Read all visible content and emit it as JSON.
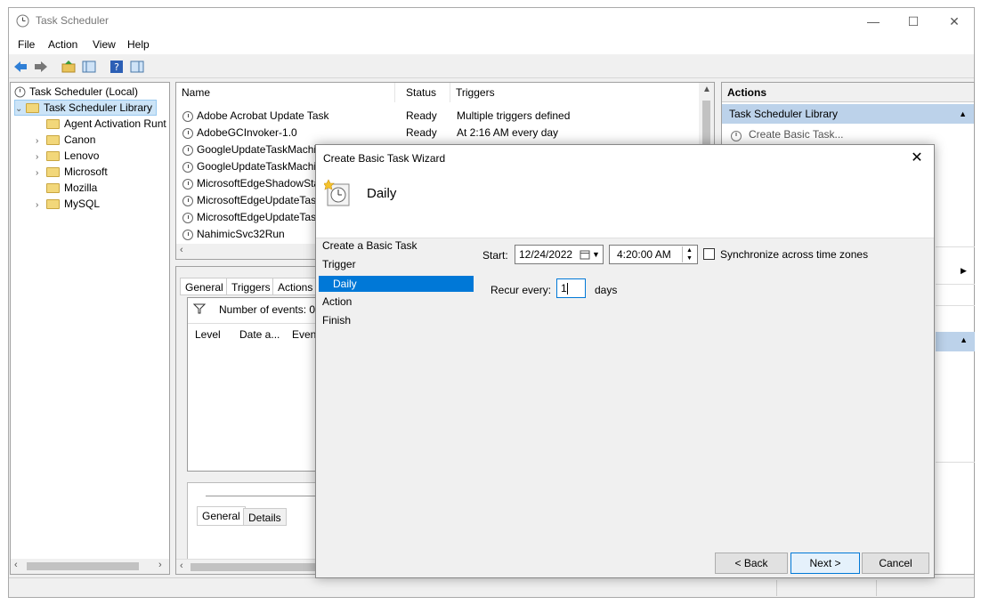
{
  "app": {
    "title": "Task Scheduler"
  },
  "menu": [
    "File",
    "Action",
    "View",
    "Help"
  ],
  "tree": {
    "root": "Task Scheduler (Local)",
    "library": "Task Scheduler Library",
    "folders": [
      "Agent Activation Runt",
      "Canon",
      "Lenovo",
      "Microsoft",
      "Mozilla",
      "MySQL"
    ]
  },
  "task_list": {
    "columns": [
      "Name",
      "Status",
      "Triggers"
    ],
    "rows": [
      {
        "name": "Adobe Acrobat Update Task",
        "status": "Ready",
        "trigger": "Multiple triggers defined"
      },
      {
        "name": "AdobeGCInvoker-1.0",
        "status": "Ready",
        "trigger": "At 2:16 AM every day"
      },
      {
        "name": "GoogleUpdateTaskMachi",
        "status": "",
        "trigger": ""
      },
      {
        "name": "GoogleUpdateTaskMachi",
        "status": "",
        "trigger": ""
      },
      {
        "name": "MicrosoftEdgeShadowSta",
        "status": "",
        "trigger": ""
      },
      {
        "name": "MicrosoftEdgeUpdateTas",
        "status": "",
        "trigger": ""
      },
      {
        "name": "MicrosoftEdgeUpdateTas",
        "status": "",
        "trigger": ""
      },
      {
        "name": "NahimicSvc32Run",
        "status": "",
        "trigger": ""
      }
    ]
  },
  "detail": {
    "tabs": [
      "General",
      "Triggers",
      "Actions"
    ],
    "events_label": "Number of events: 0",
    "event_columns": [
      "Level",
      "Date a...",
      "Event"
    ],
    "bottom_tabs": [
      "General",
      "Details"
    ]
  },
  "actions_pane": {
    "header": "Actions",
    "section": "Task Scheduler Library",
    "first_item": "Create Basic Task..."
  },
  "dialog": {
    "title": "Create Basic Task Wizard",
    "heading": "Daily",
    "steps": [
      "Create a Basic Task",
      "Trigger",
      "Daily",
      "Action",
      "Finish"
    ],
    "start_label": "Start:",
    "start_date": "12/24/2022",
    "start_time": "4:20:00 AM",
    "sync_label": "Synchronize across time zones",
    "recur_label": "Recur every:",
    "recur_value": "1",
    "recur_unit": "days",
    "buttons": {
      "back": "< Back",
      "next": "Next >",
      "cancel": "Cancel"
    }
  },
  "colors": {
    "selection": "#0078d7",
    "section_bg": "#bcd2ea"
  }
}
